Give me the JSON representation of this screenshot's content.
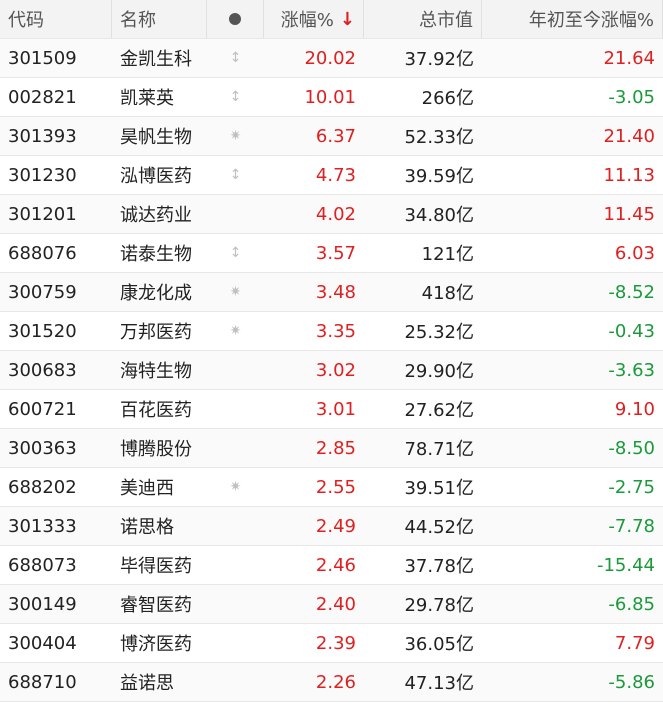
{
  "header": {
    "code": "代码",
    "name": "名称",
    "change": "涨幅%",
    "sort_arrow": "↓",
    "market_cap": "总市值",
    "ytd": "年初至今涨幅%"
  },
  "colors": {
    "up": "#e02020",
    "down": "#1a9a3a"
  },
  "rows": [
    {
      "code": "301509",
      "name": "金凯生科",
      "mark": "↕",
      "change": "20.02",
      "cap": "37.92亿",
      "ytd": "21.64",
      "ytd_dir": "up"
    },
    {
      "code": "002821",
      "name": "凯莱英",
      "mark": "↕",
      "change": "10.01",
      "cap": "266亿",
      "ytd": "-3.05",
      "ytd_dir": "down"
    },
    {
      "code": "301393",
      "name": "昊帆生物",
      "mark": "✷",
      "change": "6.37",
      "cap": "52.33亿",
      "ytd": "21.40",
      "ytd_dir": "up"
    },
    {
      "code": "301230",
      "name": "泓博医药",
      "mark": "↕",
      "change": "4.73",
      "cap": "39.59亿",
      "ytd": "11.13",
      "ytd_dir": "up"
    },
    {
      "code": "301201",
      "name": "诚达药业",
      "mark": "",
      "change": "4.02",
      "cap": "34.80亿",
      "ytd": "11.45",
      "ytd_dir": "up"
    },
    {
      "code": "688076",
      "name": "诺泰生物",
      "mark": "↕",
      "change": "3.57",
      "cap": "121亿",
      "ytd": "6.03",
      "ytd_dir": "up"
    },
    {
      "code": "300759",
      "name": "康龙化成",
      "mark": "✷",
      "change": "3.48",
      "cap": "418亿",
      "ytd": "-8.52",
      "ytd_dir": "down"
    },
    {
      "code": "301520",
      "name": "万邦医药",
      "mark": "✷",
      "change": "3.35",
      "cap": "25.32亿",
      "ytd": "-0.43",
      "ytd_dir": "down"
    },
    {
      "code": "300683",
      "name": "海特生物",
      "mark": "",
      "change": "3.02",
      "cap": "29.90亿",
      "ytd": "-3.63",
      "ytd_dir": "down"
    },
    {
      "code": "600721",
      "name": "百花医药",
      "mark": "",
      "change": "3.01",
      "cap": "27.62亿",
      "ytd": "9.10",
      "ytd_dir": "up"
    },
    {
      "code": "300363",
      "name": "博腾股份",
      "mark": "",
      "change": "2.85",
      "cap": "78.71亿",
      "ytd": "-8.50",
      "ytd_dir": "down"
    },
    {
      "code": "688202",
      "name": "美迪西",
      "mark": "✷",
      "change": "2.55",
      "cap": "39.51亿",
      "ytd": "-2.75",
      "ytd_dir": "down"
    },
    {
      "code": "301333",
      "name": "诺思格",
      "mark": "",
      "change": "2.49",
      "cap": "44.52亿",
      "ytd": "-7.78",
      "ytd_dir": "down"
    },
    {
      "code": "688073",
      "name": "毕得医药",
      "mark": "",
      "change": "2.46",
      "cap": "37.78亿",
      "ytd": "-15.44",
      "ytd_dir": "down"
    },
    {
      "code": "300149",
      "name": "睿智医药",
      "mark": "",
      "change": "2.40",
      "cap": "29.78亿",
      "ytd": "-6.85",
      "ytd_dir": "down"
    },
    {
      "code": "300404",
      "name": "博济医药",
      "mark": "",
      "change": "2.39",
      "cap": "36.05亿",
      "ytd": "7.79",
      "ytd_dir": "up"
    },
    {
      "code": "688710",
      "name": "益诺思",
      "mark": "",
      "change": "2.26",
      "cap": "47.13亿",
      "ytd": "-5.86",
      "ytd_dir": "down"
    }
  ]
}
